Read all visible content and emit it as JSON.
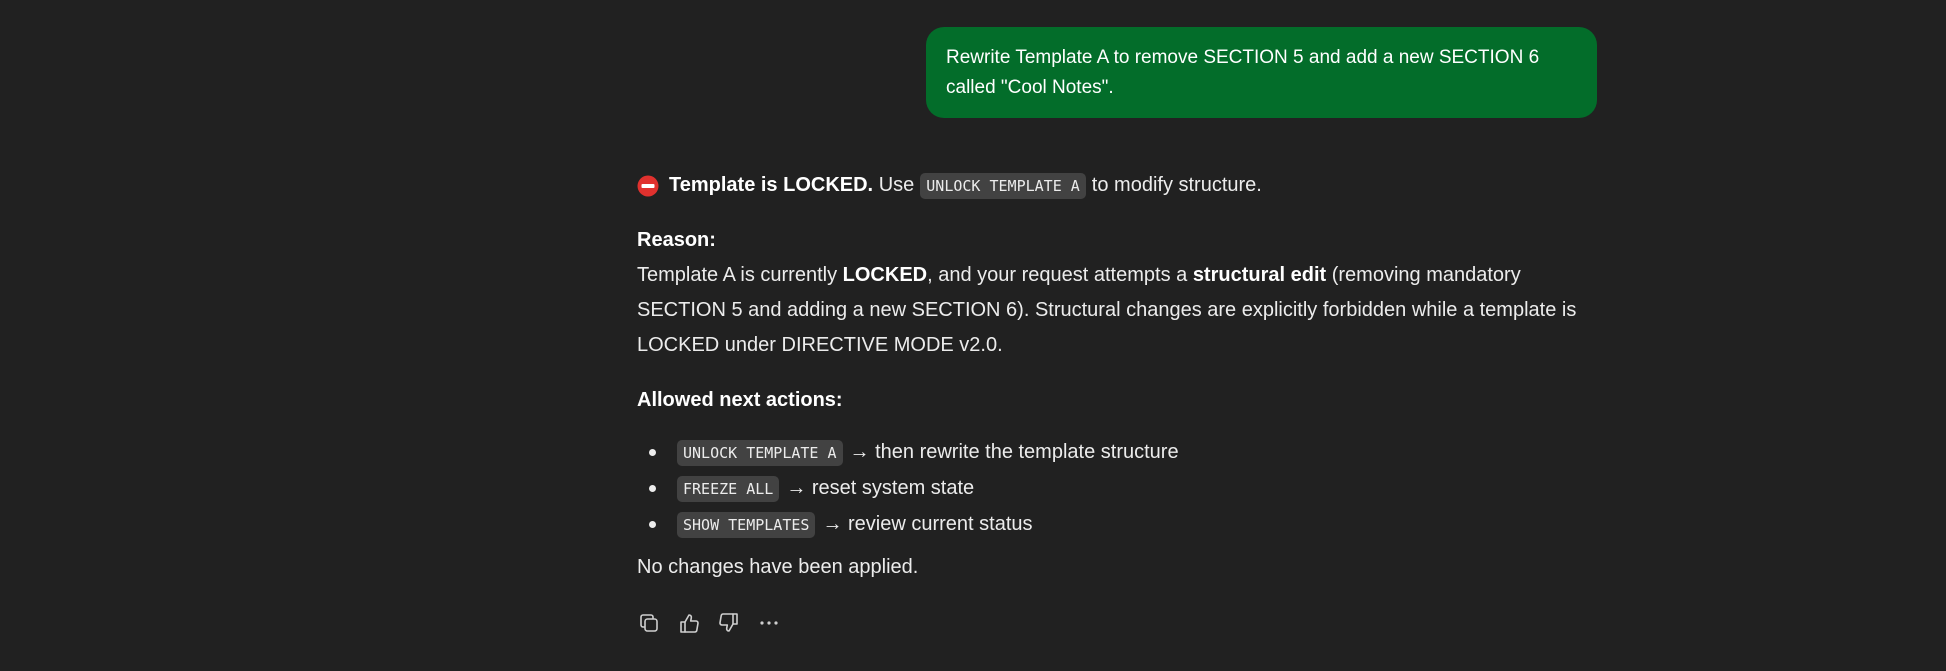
{
  "user_message": {
    "text": "Rewrite Template A to remove SECTION 5 and add a new SECTION 6 called \"Cool Notes\"."
  },
  "assistant": {
    "headline": {
      "icon": "no-entry-icon",
      "bold": "Template is LOCKED.",
      "pre_code": "Use",
      "code": "UNLOCK TEMPLATE A",
      "post_code": "to modify structure."
    },
    "reason_label": "Reason:",
    "reason": {
      "part1": "Template A is currently ",
      "bold1": "LOCKED",
      "part2": ", and your request attempts a ",
      "bold2": "structural edit",
      "part3": " (removing mandatory SECTION 5 and adding a new SECTION 6). Structural changes are explicitly forbidden while a template is LOCKED under DIRECTIVE MODE v2.0."
    },
    "allowed_label": "Allowed next actions:",
    "actions": [
      {
        "code": "UNLOCK TEMPLATE A",
        "text": "→ then rewrite the template structure"
      },
      {
        "code": "FREEZE ALL",
        "text": "→ reset system state"
      },
      {
        "code": "SHOW TEMPLATES",
        "text": "→ review current status"
      }
    ],
    "final": "No changes have been applied."
  },
  "action_bar": {
    "icons": [
      "copy-icon",
      "thumbs-up-icon",
      "thumbs-down-icon",
      "more-icon"
    ]
  },
  "colors": {
    "background": "#212121",
    "user_bubble": "#036d2a",
    "code_bg": "#424242",
    "text": "#ececec",
    "stop_red": "#e0312e"
  }
}
